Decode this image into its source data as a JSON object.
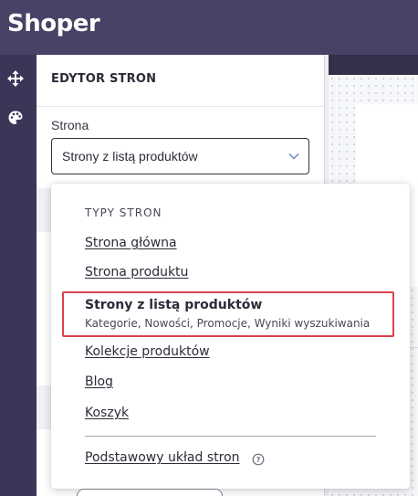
{
  "app": {
    "brand": "Shoper"
  },
  "rail": {
    "icons": [
      "move-icon",
      "palette-icon"
    ]
  },
  "panel": {
    "title": "EDYTOR STRON",
    "field_label": "Strona",
    "select_value": "Strony z listą produktów"
  },
  "dropdown": {
    "heading": "TYPY STRON",
    "items": [
      {
        "label": "Strona główna"
      },
      {
        "label": "Strona produktu"
      },
      {
        "label": "Strony z listą produktów",
        "description": "Kategorie, Nowości, Promocje, Wyniki wyszukiwania",
        "selected": true
      },
      {
        "label": "Kolekcje produktów"
      },
      {
        "label": "Blog"
      },
      {
        "label": "Koszyk"
      }
    ],
    "footer_item": "Podstawowy układ stron",
    "highlight_color": "#d9414b"
  },
  "colors": {
    "topbar": "#4a4166",
    "rail": "#3d3558",
    "text": "#2d2a38"
  }
}
